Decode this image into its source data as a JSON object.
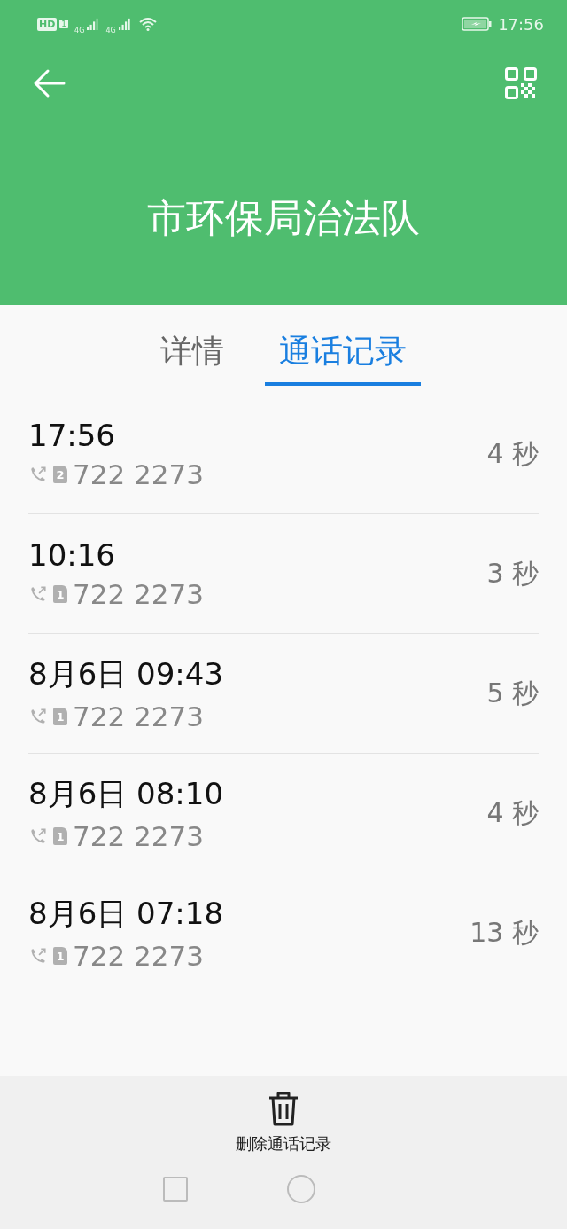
{
  "status_bar": {
    "hd": "HD",
    "hd_sim": "1",
    "networks": [
      "4G",
      "4G"
    ],
    "time": "17:56"
  },
  "title": "市环保局治法队",
  "tabs": [
    {
      "label": "详情",
      "selected": false
    },
    {
      "label": "通话记录",
      "selected": true
    }
  ],
  "calls": [
    {
      "time": "17:56",
      "sim": "2",
      "number": "722 2273",
      "duration": "4 秒"
    },
    {
      "time": "10:16",
      "sim": "1",
      "number": "722 2273",
      "duration": "3 秒"
    },
    {
      "time": "8月6日 09:43",
      "sim": "1",
      "number": "722 2273",
      "duration": "5 秒"
    },
    {
      "time": "8月6日 08:10",
      "sim": "1",
      "number": "722 2273",
      "duration": "4 秒"
    },
    {
      "time": "8月6日 07:18",
      "sim": "1",
      "number": "722 2273",
      "duration": "13 秒"
    }
  ],
  "delete_label": "删除通话记录"
}
